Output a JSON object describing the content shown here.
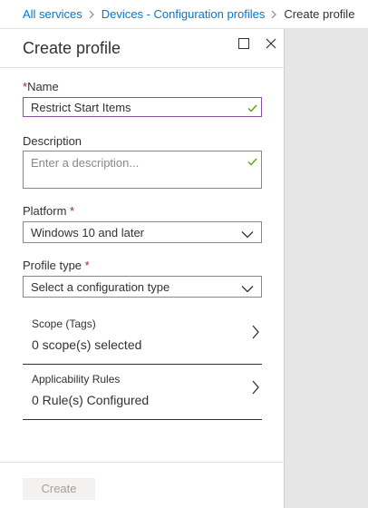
{
  "breadcrumb": {
    "items": [
      "All services",
      "Devices - Configuration profiles"
    ],
    "current": "Create profile"
  },
  "panel": {
    "title": "Create profile"
  },
  "form": {
    "name": {
      "label": "Name",
      "required_mark": "*",
      "value": "Restrict Start Items"
    },
    "description": {
      "label": "Description",
      "placeholder": "Enter a description..."
    },
    "platform": {
      "label": "Platform",
      "required_mark": "*",
      "value": "Windows 10 and later"
    },
    "profile_type": {
      "label": "Profile type",
      "required_mark": "*",
      "value": "Select a configuration type"
    },
    "scope": {
      "title": "Scope (Tags)",
      "value": "0 scope(s) selected"
    },
    "applicability": {
      "title": "Applicability Rules",
      "value": "0 Rule(s) Configured"
    }
  },
  "footer": {
    "create_label": "Create"
  },
  "colors": {
    "link": "#0078d4",
    "required": "#a4262c",
    "check": "#57a300",
    "focus_border": "#8a4fa8",
    "right_gray": "#e6e6e6"
  },
  "icons": {
    "maximize": "square-icon",
    "close": "close-icon",
    "valid": "checkmark-icon",
    "dropdown": "chevron-down-icon",
    "navigate": "chevron-right-icon",
    "breadcrumb_separator": "chevron-right-icon"
  }
}
